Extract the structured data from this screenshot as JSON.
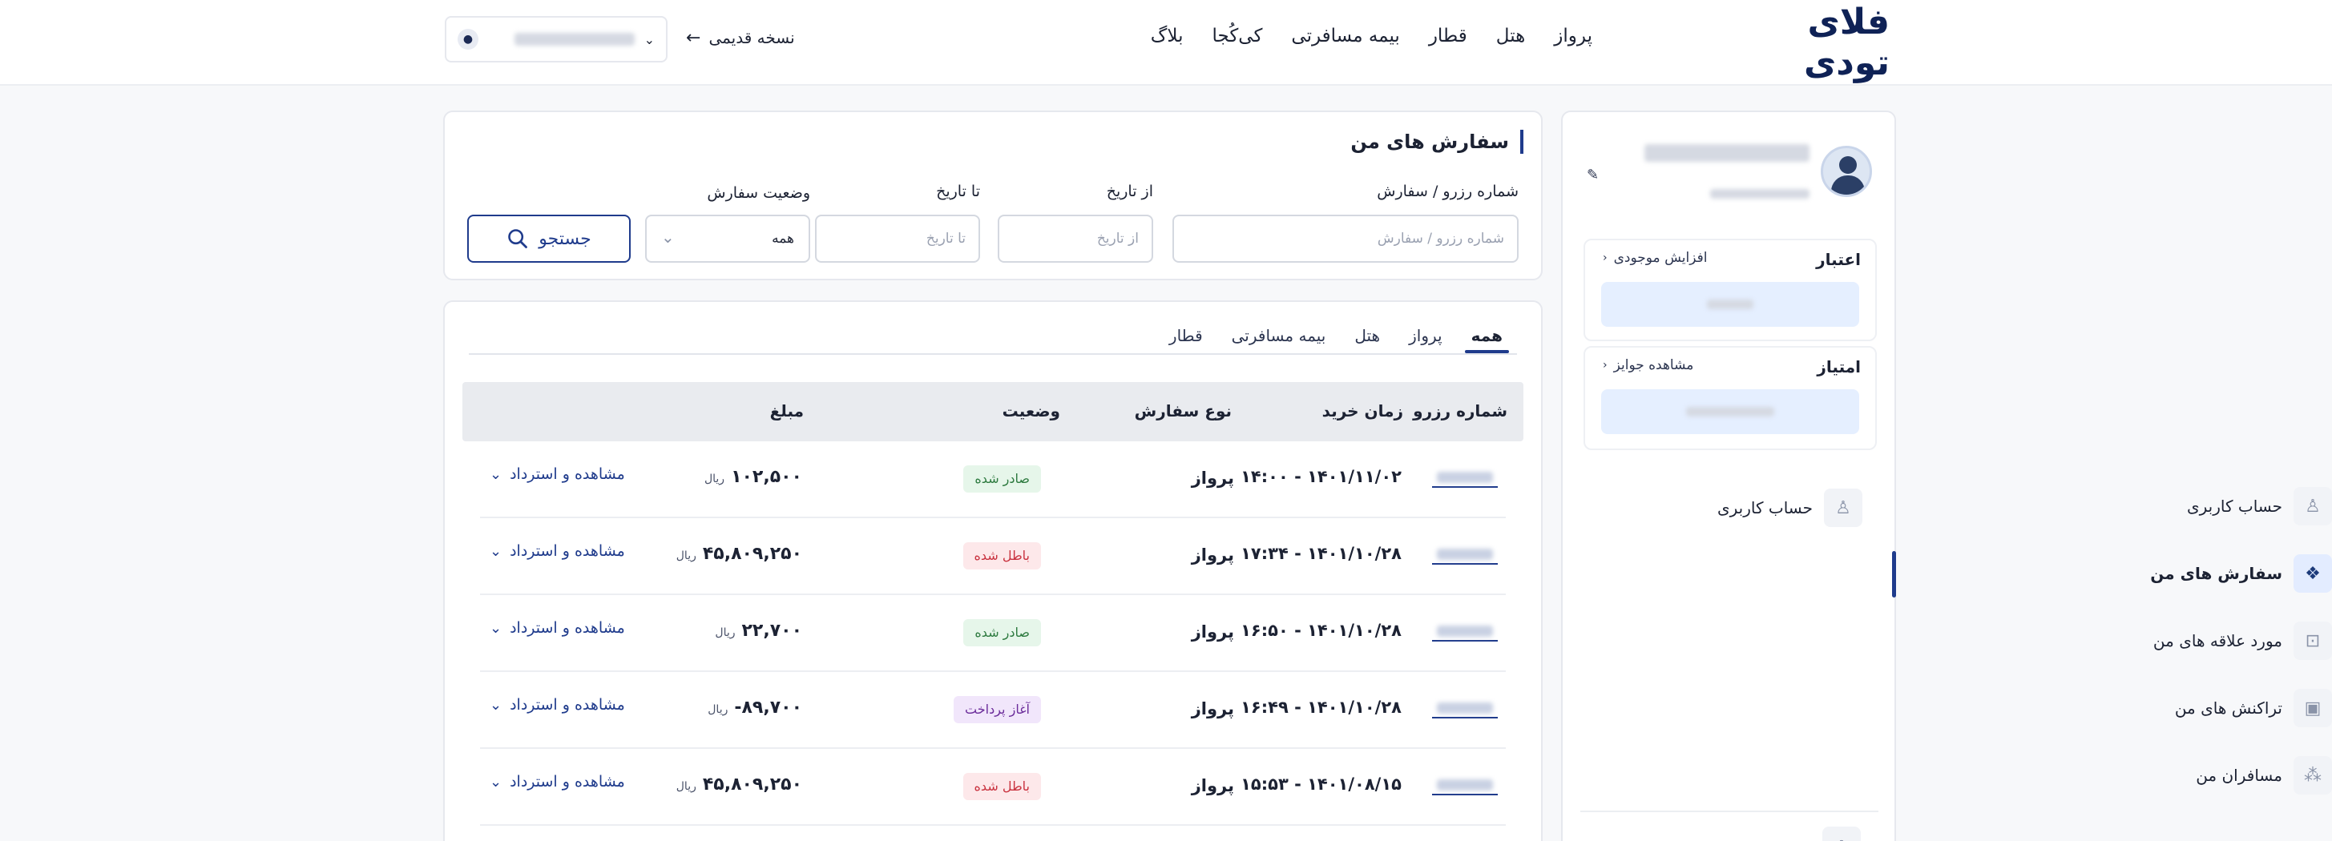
{
  "header": {
    "logo": "فلای تودی",
    "nav": [
      "پرواز",
      "هتل",
      "قطار",
      "بیمه مسافرتی",
      "کی‌کُجا",
      "بلاگ"
    ],
    "old_version": "نسخه قدیمی"
  },
  "sidebar": {
    "credit": {
      "title": "اعتبار",
      "link": "افزایش موجودی"
    },
    "points": {
      "title": "امتیاز",
      "link": "مشاهده جوایز"
    },
    "menu": [
      {
        "label": "حساب کاربری",
        "icon": "user-icon"
      },
      {
        "label": "سفارش های من",
        "icon": "orders-icon",
        "active": true
      },
      {
        "label": "مورد علاقه های من",
        "icon": "favorites-icon"
      },
      {
        "label": "تراکنش های من",
        "icon": "wallet-icon"
      },
      {
        "label": "مسافران من",
        "icon": "passengers-icon"
      }
    ]
  },
  "search": {
    "title": "سفارش های من",
    "order_number": {
      "label": "شماره رزرو / سفارش",
      "placeholder": "شماره رزرو / سفارش"
    },
    "from_date": {
      "label": "از تاریخ",
      "placeholder": "از تاریخ"
    },
    "to_date": {
      "label": "تا تاریخ",
      "placeholder": "تا تاریخ"
    },
    "status": {
      "label": "وضعیت سفارش",
      "value": "همه"
    },
    "button": "جستجو"
  },
  "orders": {
    "tabs": [
      "همه",
      "پرواز",
      "هتل",
      "بیمه مسافرتی",
      "قطار"
    ],
    "active_tab": "همه",
    "columns": {
      "res": "شماره رزرو",
      "time": "زمان خرید",
      "type": "نوع سفارش",
      "status": "وضعیت",
      "amount": "مبلغ"
    },
    "currency": "ریال",
    "action": "مشاهده و استرداد",
    "rows": [
      {
        "time": "۱۴۰۱/۱۱/۰۲ - ۱۴:۰۰",
        "type": "پرواز",
        "status": "صادر شده",
        "status_color": "green",
        "amount": "۱۰۲,۵۰۰"
      },
      {
        "time": "۱۴۰۱/۱۰/۲۸ - ۱۷:۳۴",
        "type": "پرواز",
        "status": "باطل شده",
        "status_color": "red",
        "amount": "۴۵,۸۰۹,۲۵۰"
      },
      {
        "time": "۱۴۰۱/۱۰/۲۸ - ۱۶:۵۰",
        "type": "پرواز",
        "status": "صادر شده",
        "status_color": "green",
        "amount": "۲۲,۷۰۰"
      },
      {
        "time": "۱۴۰۱/۱۰/۲۸ - ۱۶:۴۹",
        "type": "پرواز",
        "status": "آغاز پرداخت",
        "status_color": "purple",
        "amount": "۸۹,۷۰۰-"
      },
      {
        "time": "۱۴۰۱/۰۸/۱۵ - ۱۵:۵۳",
        "type": "پرواز",
        "status": "باطل شده",
        "status_color": "red",
        "amount": "۴۵,۸۰۹,۲۵۰"
      }
    ]
  }
}
